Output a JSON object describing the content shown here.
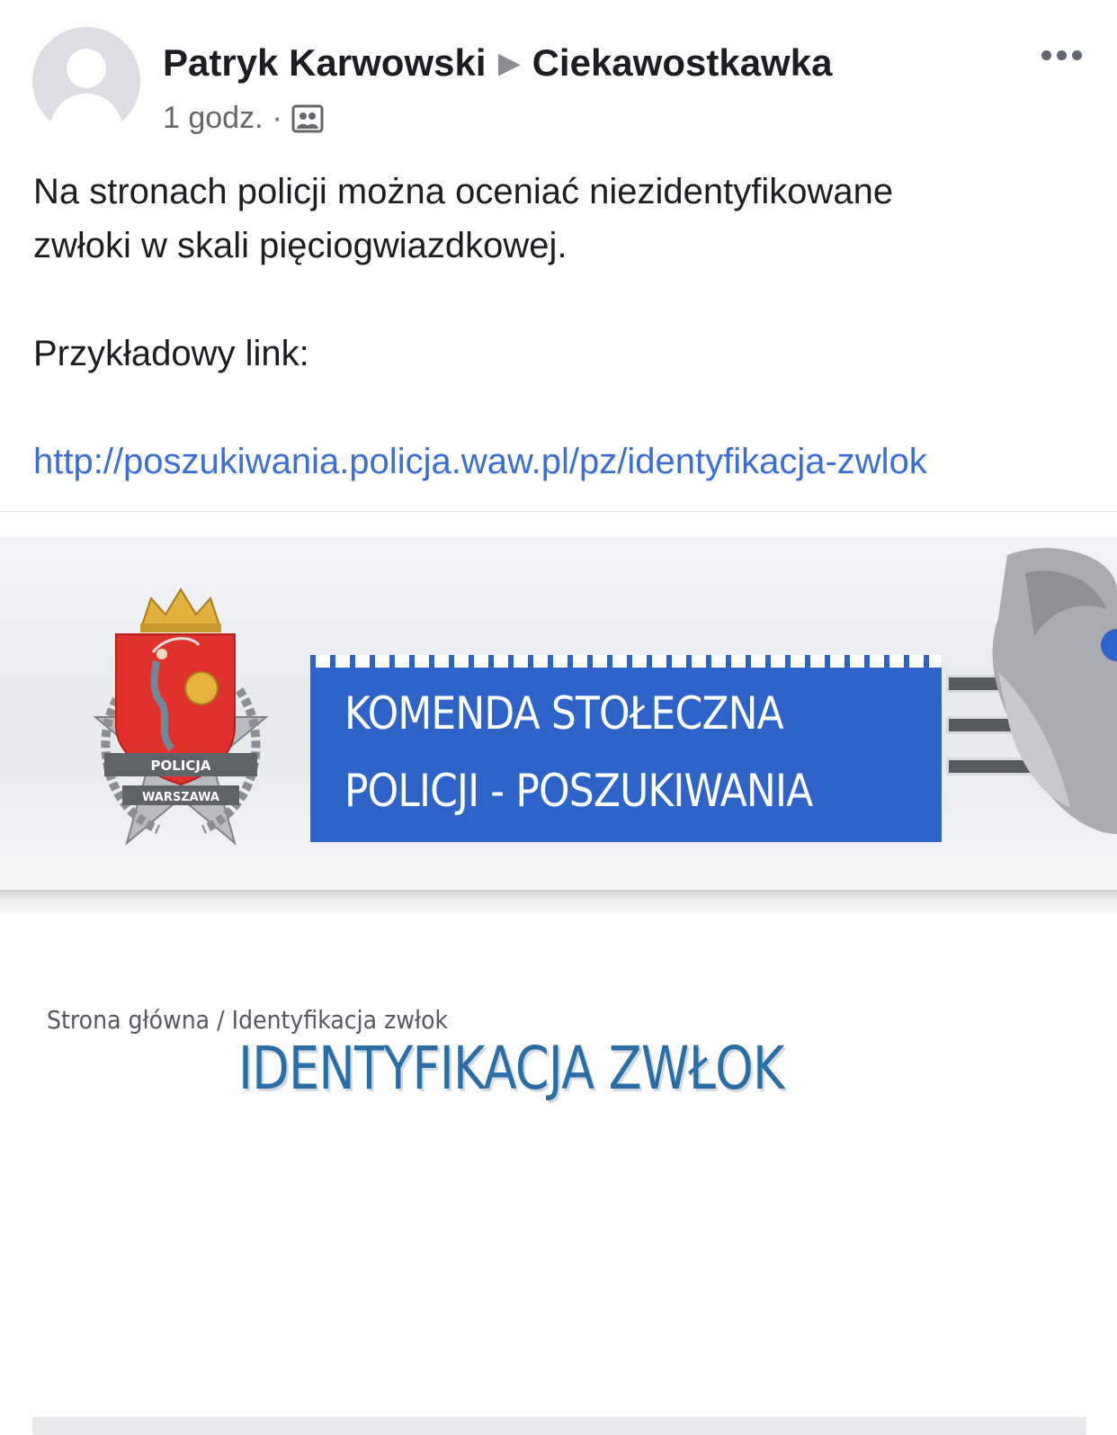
{
  "post": {
    "author": "Patryk Karwowski",
    "separator": "▶",
    "group": "Ciekawostkawka",
    "time": "1 godz.",
    "dot": "·",
    "audience_icon": "group-audience-icon",
    "more_icon": "more-options-icon",
    "text_line1": "Na stronach policji można oceniać niezidentyfikowane",
    "text_line2": "zwłoki w skali pięciogwiazdkowej.",
    "text_line3": "Przykładowy link:",
    "link": "http://poszukiwania.policja.waw.pl/pz/identyfikacja-zwlok"
  },
  "preview": {
    "banner_line1": "KOMENDA STOŁECZNA",
    "banner_line2": "POLICJI - POSZUKIWANIA",
    "emblem_text_top": "POLICJA",
    "emblem_text_bottom": "WARSZAWA",
    "breadcrumb": "Strona główna  / Identyfikacja zwłok",
    "heading": "IDENTYFIKACJA ZWŁOK",
    "colors": {
      "banner_blue": "#2e63c9",
      "heading_blue": "#2a6ea8",
      "link_blue": "#3b6fd6"
    }
  }
}
